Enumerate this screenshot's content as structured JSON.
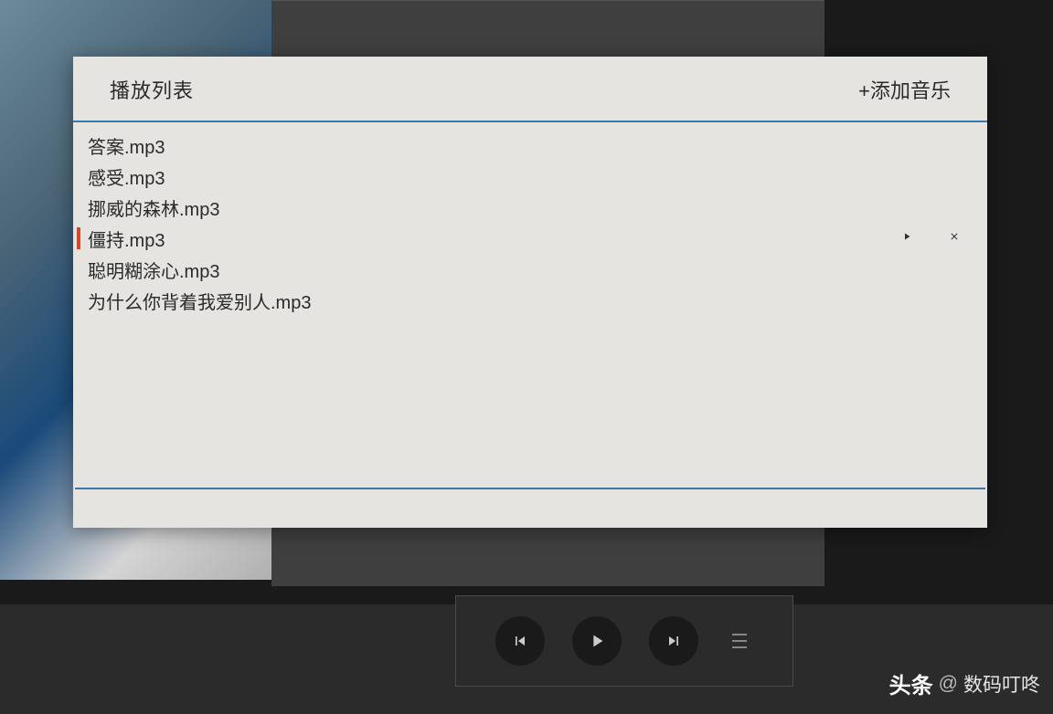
{
  "playlist": {
    "title": "播放列表",
    "add_label": "+添加音乐",
    "tracks": [
      {
        "name": "答案.mp3",
        "active": false
      },
      {
        "name": "感受.mp3",
        "active": false
      },
      {
        "name": "挪威的森林.mp3",
        "active": false
      },
      {
        "name": "僵持.mp3",
        "active": true
      },
      {
        "name": "聪明糊涂心.mp3",
        "active": false
      },
      {
        "name": "为什么你背着我爱别人.mp3",
        "active": false
      }
    ]
  },
  "watermark": {
    "brand": "头条",
    "at": "@",
    "name": "数码叮咚"
  }
}
